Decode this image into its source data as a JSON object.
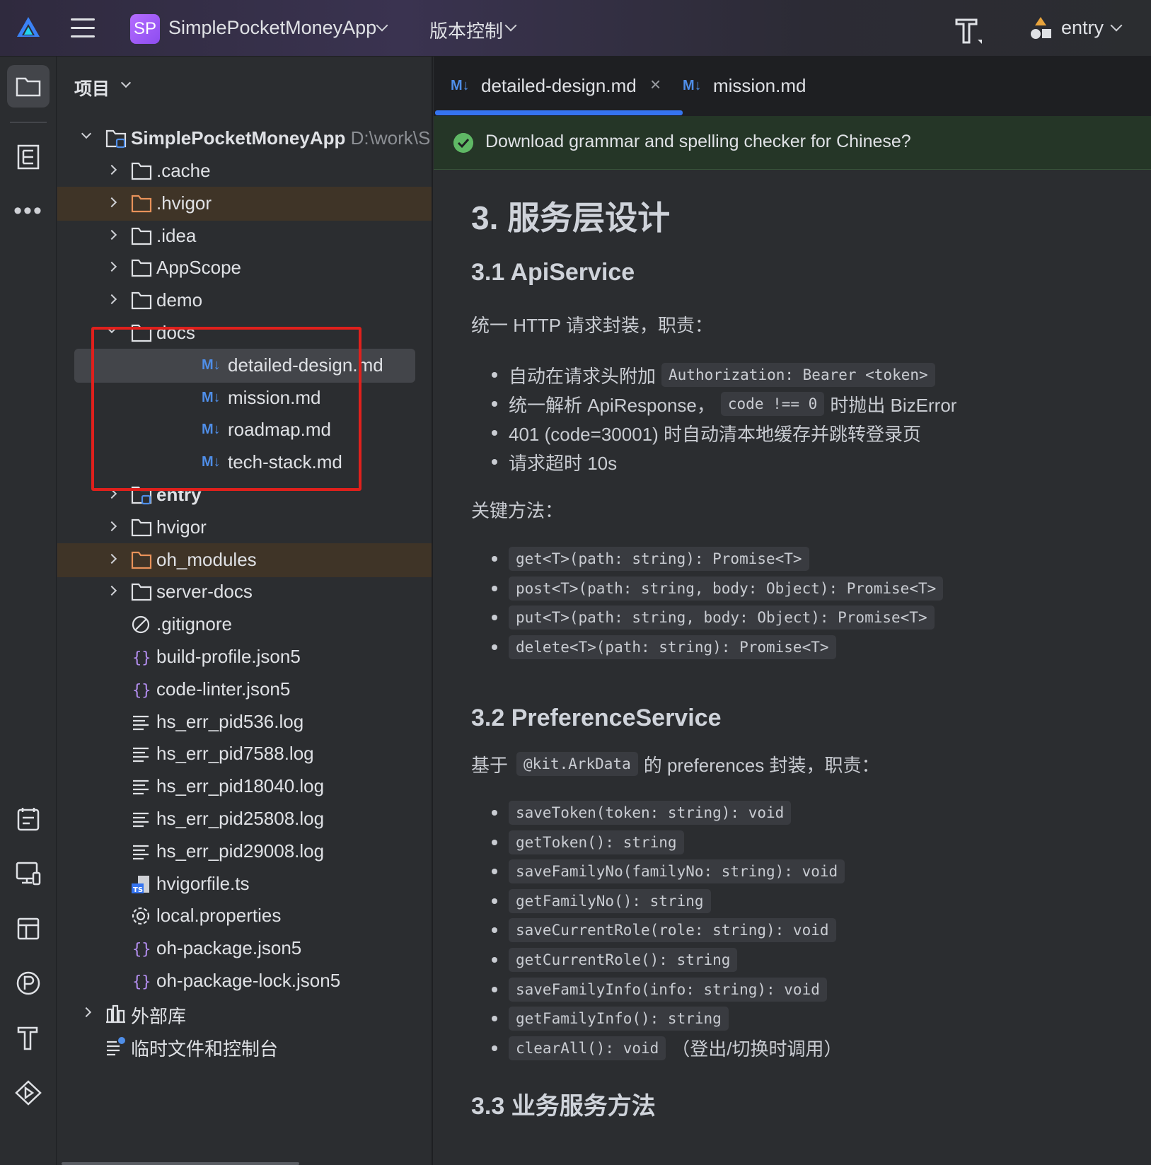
{
  "topbar": {
    "project_badge": "SP",
    "project_name": "SimplePocketMoneyApp",
    "vcs_label": "版本控制",
    "run_config": "entry"
  },
  "panel": {
    "title": "项目",
    "root": {
      "name": "SimplePocketMoneyApp",
      "path": "D:\\work\\S"
    },
    "items": [
      {
        "label": ".cache"
      },
      {
        "label": ".hvigor"
      },
      {
        "label": ".idea"
      },
      {
        "label": "AppScope"
      },
      {
        "label": "demo"
      },
      {
        "label": "docs"
      },
      {
        "label": "detailed-design.md",
        "badge": "M↓"
      },
      {
        "label": "mission.md",
        "badge": "M↓"
      },
      {
        "label": "roadmap.md",
        "badge": "M↓"
      },
      {
        "label": "tech-stack.md",
        "badge": "M↓"
      },
      {
        "label": "entry"
      },
      {
        "label": "hvigor"
      },
      {
        "label": "oh_modules"
      },
      {
        "label": "server-docs"
      },
      {
        "label": ".gitignore"
      },
      {
        "label": "build-profile.json5"
      },
      {
        "label": "code-linter.json5"
      },
      {
        "label": "hs_err_pid536.log"
      },
      {
        "label": "hs_err_pid7588.log"
      },
      {
        "label": "hs_err_pid18040.log"
      },
      {
        "label": "hs_err_pid25808.log"
      },
      {
        "label": "hs_err_pid29008.log"
      },
      {
        "label": "hvigorfile.ts"
      },
      {
        "label": "local.properties"
      },
      {
        "label": "oh-package.json5"
      },
      {
        "label": "oh-package-lock.json5"
      },
      {
        "label": "外部库"
      },
      {
        "label": "临时文件和控制台"
      }
    ]
  },
  "editor": {
    "tabs": [
      {
        "badge": "M↓",
        "label": "detailed-design.md",
        "close": "×"
      },
      {
        "badge": "M↓",
        "label": "mission.md"
      }
    ],
    "notification": "Download grammar and spelling checker for Chinese?",
    "doc": {
      "h2": "3. 服务层设计",
      "s1": {
        "title": "3.1 ApiService",
        "intro": "统一 HTTP 请求封装，职责：",
        "b1_text": "自动在请求头附加",
        "b1_code": "Authorization: Bearer <token>",
        "b2_text_a": "统一解析 ApiResponse，",
        "b2_code": "code !== 0",
        "b2_text_b": "时抛出 BizError",
        "b3": "401 (code=30001) 时自动清本地缓存并跳转登录页",
        "b4": "请求超时 10s",
        "methods_title": "关键方法：",
        "methods": [
          "get<T>(path: string): Promise<T>",
          "post<T>(path: string, body: Object): Promise<T>",
          "put<T>(path: string, body: Object): Promise<T>",
          "delete<T>(path: string): Promise<T>"
        ]
      },
      "s2": {
        "title": "3.2 PreferenceService",
        "intro_a": "基于",
        "intro_code": "@kit.ArkData",
        "intro_b": "的 preferences 封装，职责：",
        "methods": [
          "saveToken(token: string): void",
          "getToken(): string",
          "saveFamilyNo(familyNo: string): void",
          "getFamilyNo(): string",
          "saveCurrentRole(role: string): void",
          "getCurrentRole(): string",
          "saveFamilyInfo(info: string): void",
          "getFamilyInfo(): string",
          "clearAll(): void"
        ],
        "last_note": "（登出/切换时调用）"
      },
      "s3": {
        "title": "3.3 业务服务方法"
      }
    }
  }
}
